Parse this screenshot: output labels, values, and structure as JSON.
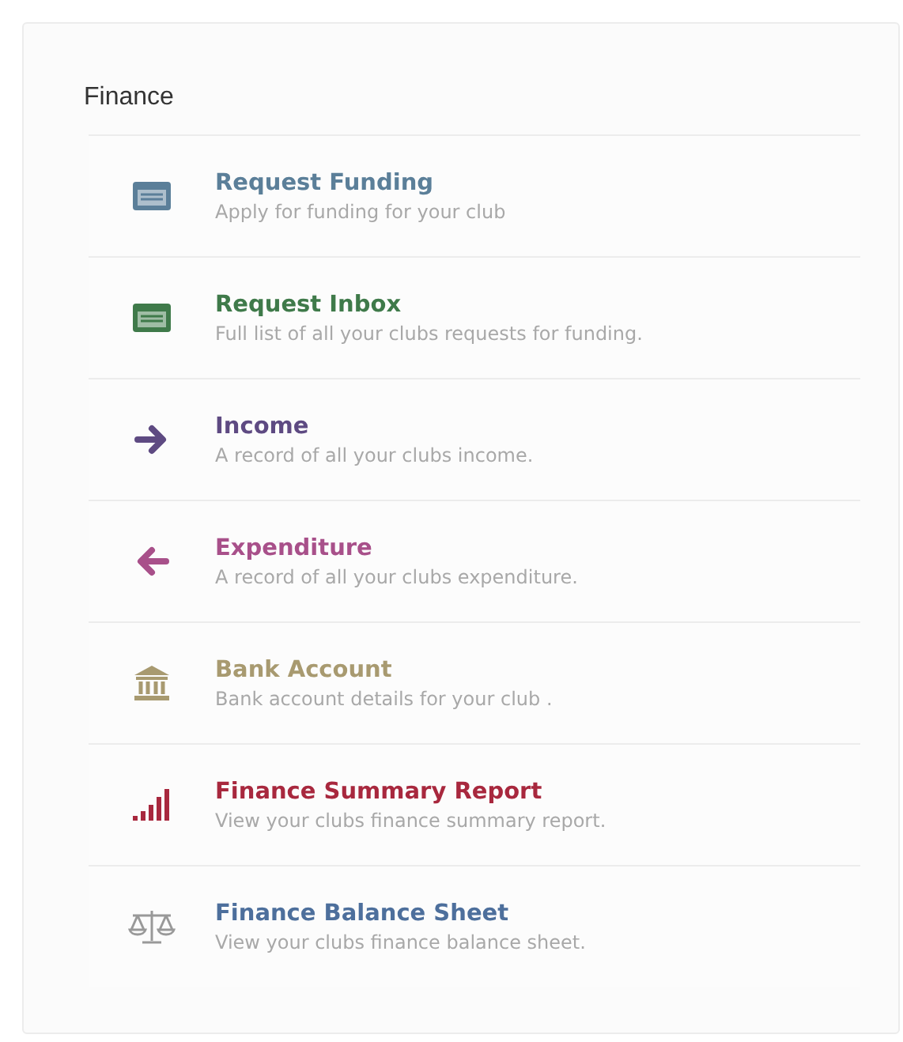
{
  "panel": {
    "title": "Finance"
  },
  "items": [
    {
      "kind": "form",
      "title": "Request Funding",
      "description": "Apply for funding for your club",
      "color": "#5b7f99"
    },
    {
      "kind": "form",
      "title": "Request Inbox",
      "description": "Full list of all your clubs requests for funding.",
      "color": "#3f7a4a"
    },
    {
      "kind": "inbound",
      "title": "Income",
      "description": "A record of all your clubs income.",
      "color": "#5e4a82"
    },
    {
      "kind": "outbound",
      "title": "Expenditure",
      "description": "A record of all your clubs expenditure.",
      "color": "#a8508a"
    },
    {
      "kind": "bank",
      "title": "Bank Account",
      "description": "Bank account details for your club .",
      "color": "#a89a70"
    },
    {
      "kind": "chart",
      "title": "Finance Summary Report",
      "description": "View your clubs finance summary report.",
      "color": "#a8283e"
    },
    {
      "kind": "scale",
      "title": "Finance Balance Sheet",
      "description": "View your clubs finance balance sheet.",
      "color": "#4d6f9c"
    }
  ]
}
